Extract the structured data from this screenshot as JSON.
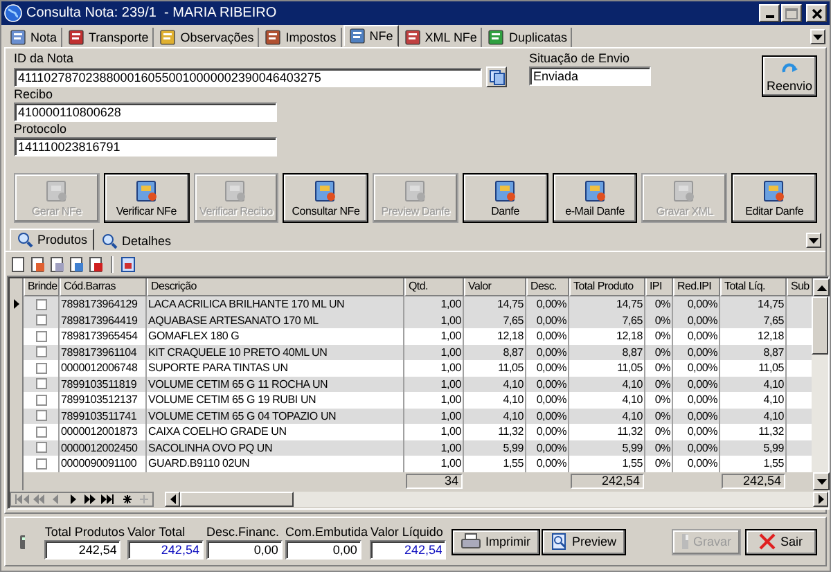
{
  "window": {
    "title": "Consulta Nota: 239/1  - MARIA RIBEIRO"
  },
  "tabs": [
    {
      "label": "Nota",
      "selected": false
    },
    {
      "label": "Transporte",
      "selected": false
    },
    {
      "label": "Observações",
      "selected": false
    },
    {
      "label": "Impostos",
      "selected": false
    },
    {
      "label": "NFe",
      "selected": true
    },
    {
      "label": "XML NFe",
      "selected": false
    },
    {
      "label": "Duplicatas",
      "selected": false
    }
  ],
  "nfe": {
    "id_label": "ID da Nota",
    "id_value": "41110278702388000160550010000002390046403275",
    "status_label": "Situação de Envio",
    "status_value": "Enviada",
    "receipt_label": "Recibo",
    "receipt_value": "410000110800628",
    "protocol_label": "Protocolo",
    "protocol_value": "141110023816791",
    "resend_button": "Reenvio"
  },
  "actions": [
    {
      "label": "Gerar NFe",
      "disabled": true
    },
    {
      "label": "Verificar NFe",
      "disabled": false
    },
    {
      "label": "Verificar Recibo",
      "disabled": true
    },
    {
      "label": "Consultar NFe",
      "disabled": false
    },
    {
      "label": "Preview Danfe",
      "disabled": true
    },
    {
      "label": "Danfe",
      "disabled": false
    },
    {
      "label": "e-Mail Danfe",
      "disabled": false
    },
    {
      "label": "Gravar XML",
      "disabled": true
    },
    {
      "label": "Editar Danfe",
      "disabled": false
    }
  ],
  "subtabs": [
    {
      "label": "Produtos",
      "selected": true
    },
    {
      "label": "Detalhes",
      "selected": false
    }
  ],
  "grid": {
    "columns": [
      "Brinde",
      "Cód.Barras",
      "Descrição",
      "Qtd.",
      "Valor",
      "Desc.",
      "Total Produto",
      "IPI",
      "Red.IPI",
      "Total Líq.",
      "Sub"
    ],
    "rows": [
      {
        "selected": true,
        "brinde": false,
        "barcode": "7898173964129",
        "description": "LACA ACRILICA BRILHANTE 170 ML UN",
        "qty": "1,00",
        "price": "14,75",
        "discount": "0,00%",
        "total": "14,75",
        "ipi": "0%",
        "red_ipi": "0,00%",
        "net_total": "14,75"
      },
      {
        "selected": false,
        "brinde": false,
        "barcode": "7898173964419",
        "description": "AQUABASE ARTESANATO 170 ML",
        "qty": "1,00",
        "price": "7,65",
        "discount": "0,00%",
        "total": "7,65",
        "ipi": "0%",
        "red_ipi": "0,00%",
        "net_total": "7,65"
      },
      {
        "selected": false,
        "brinde": false,
        "barcode": "7898173965454",
        "description": "GOMAFLEX 180 G",
        "qty": "1,00",
        "price": "12,18",
        "discount": "0,00%",
        "total": "12,18",
        "ipi": "0%",
        "red_ipi": "0,00%",
        "net_total": "12,18"
      },
      {
        "selected": false,
        "brinde": false,
        "barcode": "7898173961104",
        "description": "KIT CRAQUELE 10 PRETO 40ML UN",
        "qty": "1,00",
        "price": "8,87",
        "discount": "0,00%",
        "total": "8,87",
        "ipi": "0%",
        "red_ipi": "0,00%",
        "net_total": "8,87"
      },
      {
        "selected": false,
        "brinde": false,
        "barcode": "0000012006748",
        "description": "SUPORTE PARA TINTAS UN",
        "qty": "1,00",
        "price": "11,05",
        "discount": "0,00%",
        "total": "11,05",
        "ipi": "0%",
        "red_ipi": "0,00%",
        "net_total": "11,05"
      },
      {
        "selected": false,
        "brinde": false,
        "barcode": "7899103511819",
        "description": "VOLUME CETIM 65 G 11 ROCHA UN",
        "qty": "1,00",
        "price": "4,10",
        "discount": "0,00%",
        "total": "4,10",
        "ipi": "0%",
        "red_ipi": "0,00%",
        "net_total": "4,10"
      },
      {
        "selected": false,
        "brinde": false,
        "barcode": "7899103512137",
        "description": "VOLUME CETIM 65 G 19 RUBI UN",
        "qty": "1,00",
        "price": "4,10",
        "discount": "0,00%",
        "total": "4,10",
        "ipi": "0%",
        "red_ipi": "0,00%",
        "net_total": "4,10"
      },
      {
        "selected": false,
        "brinde": false,
        "barcode": "7899103511741",
        "description": "VOLUME CETIM 65 G 04 TOPAZIO UN",
        "qty": "1,00",
        "price": "4,10",
        "discount": "0,00%",
        "total": "4,10",
        "ipi": "0%",
        "red_ipi": "0,00%",
        "net_total": "4,10"
      },
      {
        "selected": false,
        "brinde": false,
        "barcode": "0000012001873",
        "description": "CAIXA COELHO GRADE UN",
        "qty": "1,00",
        "price": "11,32",
        "discount": "0,00%",
        "total": "11,32",
        "ipi": "0%",
        "red_ipi": "0,00%",
        "net_total": "11,32"
      },
      {
        "selected": false,
        "brinde": false,
        "barcode": "0000012002450",
        "description": "SACOLINHA OVO PQ UN",
        "qty": "1,00",
        "price": "5,99",
        "discount": "0,00%",
        "total": "5,99",
        "ipi": "0%",
        "red_ipi": "0,00%",
        "net_total": "5,99"
      },
      {
        "selected": false,
        "brinde": false,
        "barcode": "0000090091100",
        "description": "GUARD.B9110 02UN",
        "qty": "1,00",
        "price": "1,55",
        "discount": "0,00%",
        "total": "1,55",
        "ipi": "0%",
        "red_ipi": "0,00%",
        "net_total": "1,55"
      }
    ],
    "footer": {
      "qty": "34",
      "total": "242,54",
      "net_total": "242,54"
    }
  },
  "totals": [
    {
      "label": "Total Produtos",
      "value": "242,54",
      "emphasis": false
    },
    {
      "label": "Valor Total",
      "value": "242,54",
      "emphasis": true
    },
    {
      "label": "Desc.Financ.",
      "value": "0,00",
      "emphasis": false
    },
    {
      "label": "Com.Embutida",
      "value": "0,00",
      "emphasis": false
    },
    {
      "label": "Valor Líquido",
      "value": "242,54",
      "emphasis": true
    }
  ],
  "bottom_buttons": [
    {
      "label": "Imprimir",
      "kind": "print",
      "disabled": false
    },
    {
      "label": "Preview",
      "kind": "preview",
      "disabled": false
    },
    {
      "label": "Gravar",
      "kind": "save",
      "disabled": true
    },
    {
      "label": "Sair",
      "kind": "exit",
      "disabled": false
    }
  ]
}
